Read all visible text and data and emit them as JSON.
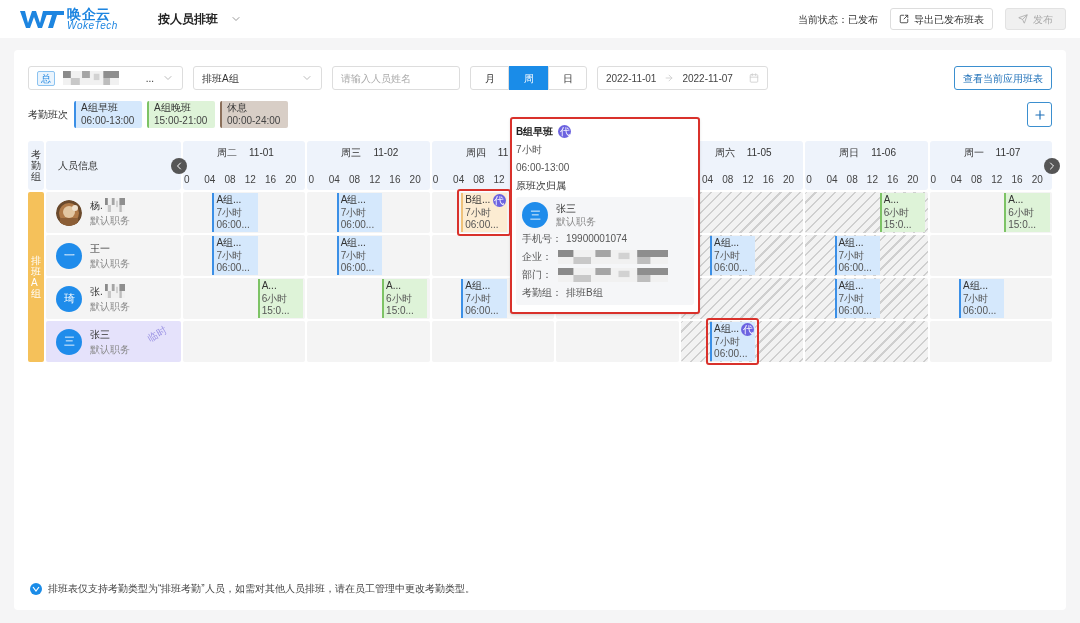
{
  "header": {
    "brand": "唤企云",
    "brand_sub": "WokeTech",
    "title": "按人员排班",
    "status": "当前状态：已发布",
    "export_button": "导出已发布班表",
    "publish_button": {
      "label": "发布",
      "disabled": true
    }
  },
  "filters": {
    "org_select": {
      "tag": "总",
      "value": "...",
      "redacted": true
    },
    "group_select": {
      "value": "排班A组"
    },
    "search": {
      "placeholder": "请输入人员姓名"
    },
    "views": [
      {
        "label": "月",
        "selected": false
      },
      {
        "label": "周",
        "selected": true
      },
      {
        "label": "日",
        "selected": false
      }
    ],
    "date_start": "2022-11-01",
    "date_end": "2022-11-07",
    "view_button": "查看当前应用班表"
  },
  "legend": {
    "label": "考勤班次",
    "shifts": [
      {
        "kind": "early",
        "name": "A组早班",
        "time": "06:00-13:00"
      },
      {
        "kind": "late",
        "name": "A组晚班",
        "time": "15:00-21:00"
      },
      {
        "kind": "rest",
        "name": "休息",
        "time": "00:00-24:00"
      }
    ]
  },
  "grid": {
    "group_header": "考勤组",
    "person_header": "人员信息",
    "group_name": "排班A组",
    "days": [
      {
        "weekday": "周二",
        "date": "11-01",
        "leading_gap": false,
        "hatched": false,
        "ticks": [
          "0",
          "04",
          "08",
          "12",
          "16",
          "20"
        ]
      },
      {
        "weekday": "周三",
        "date": "11-02",
        "leading_gap": false,
        "hatched": false,
        "ticks": [
          "0",
          "04",
          "08",
          "12",
          "16",
          "20"
        ]
      },
      {
        "weekday": "周四",
        "date": "11",
        "leading_gap": false,
        "hatched": false,
        "ticks": [
          "0",
          "04",
          "08",
          "12"
        ]
      },
      {
        "hatched": false
      },
      {
        "weekday": "周六",
        "date": "11-05",
        "leading_gap": true,
        "hatched": true,
        "ticks": [
          "04",
          "08",
          "12",
          "16",
          "20"
        ]
      },
      {
        "weekday": "周日",
        "date": "11-06",
        "leading_gap": false,
        "hatched": true,
        "ticks": [
          "0",
          "04",
          "08",
          "12",
          "16",
          "20"
        ]
      },
      {
        "weekday": "周一",
        "date": "11-07",
        "leading_gap": false,
        "hatched": false,
        "ticks": [
          "0",
          "04",
          "08",
          "12",
          "16",
          "20"
        ]
      }
    ],
    "rows": [
      {
        "name": "杨.",
        "role": "默认职务",
        "redacted": true,
        "selected": false,
        "cells": [
          {
            "kind": "early",
            "title": "A组...",
            "hours": "7小时",
            "time": "06:00...",
            "highlighted": false
          },
          {
            "kind": "early",
            "title": "A组...",
            "hours": "7小时",
            "time": "06:00...",
            "highlighted": false
          },
          {
            "kind": "b_early",
            "title": "B组...",
            "hours": "7小时",
            "time": "06:00...",
            "badge": "代",
            "highlighted": true
          },
          {
            "kind": "empty"
          },
          {
            "kind": "empty"
          },
          {
            "kind": "late",
            "title": "A...",
            "hours": "6小时",
            "time": "15:0...",
            "highlighted": false
          },
          {
            "kind": "late",
            "title": "A...",
            "hours": "6小时",
            "time": "15:0...",
            "highlighted": false
          }
        ]
      },
      {
        "name": "王一",
        "role": "默认职务",
        "avatar": {
          "kind": "initial",
          "text": "一"
        },
        "redacted": false,
        "selected": false,
        "cells": [
          {
            "kind": "early",
            "title": "A组...",
            "hours": "7小时",
            "time": "06:00...",
            "highlighted": false
          },
          {
            "kind": "early",
            "title": "A组...",
            "hours": "7小时",
            "time": "06:00...",
            "highlighted": false
          },
          {
            "kind": "empty"
          },
          {
            "kind": "empty"
          },
          {
            "kind": "early",
            "title": "A组...",
            "hours": "7小时",
            "time": "06:00...",
            "highlighted": false
          },
          {
            "kind": "early",
            "title": "A组...",
            "hours": "7小时",
            "time": "06:00...",
            "highlighted": false
          },
          {
            "kind": "empty"
          }
        ]
      },
      {
        "name": "张.",
        "role": "默认职务",
        "avatar": {
          "kind": "initial",
          "text": "琦"
        },
        "redacted": true,
        "selected": false,
        "cells": [
          {
            "kind": "late",
            "title": "A...",
            "hours": "6小时",
            "time": "15:0...",
            "highlighted": false
          },
          {
            "kind": "late",
            "title": "A...",
            "hours": "6小时",
            "time": "15:0...",
            "highlighted": false
          },
          {
            "kind": "early",
            "title": "A组...",
            "hours": "7小时",
            "time": "06:00...",
            "highlighted": false
          },
          {
            "kind": "empty"
          },
          {
            "kind": "empty"
          },
          {
            "kind": "early",
            "title": "A组...",
            "hours": "7小时",
            "time": "06:00...",
            "highlighted": false
          },
          {
            "kind": "early",
            "title": "A组...",
            "hours": "7小时",
            "time": "06:00...",
            "highlighted": false
          }
        ]
      },
      {
        "name": "张三",
        "role": "默认职务",
        "avatar": {
          "kind": "initial",
          "text": "三"
        },
        "redacted": false,
        "selected": true,
        "mark": "临时",
        "cells": [
          {
            "kind": "empty"
          },
          {
            "kind": "empty"
          },
          {
            "kind": "empty"
          },
          {
            "kind": "empty"
          },
          {
            "kind": "early",
            "title": "A组...",
            "hours": "7小时",
            "time": "06:00...",
            "badge": "代",
            "highlighted": true
          },
          {
            "kind": "empty"
          },
          {
            "kind": "empty"
          }
        ]
      }
    ]
  },
  "popover": {
    "title": "B组早班",
    "badge": "代",
    "hours": "7小时",
    "time": "06:00-13:00",
    "section": "原班次归属",
    "person": {
      "avatar": "三",
      "name": "张三",
      "role": "默认职务"
    },
    "fields": [
      {
        "label": "手机号：",
        "value": "19900001074",
        "redacted": false
      },
      {
        "label": "企业：",
        "redacted": true
      },
      {
        "label": "部门：",
        "redacted": true
      },
      {
        "label": "考勤组：",
        "value": "排班B组",
        "redacted": false
      }
    ]
  },
  "footer_note": "排班表仅支持考勤类型为“排班考勤”人员，如需对其他人员排班，请在员工管理中更改考勤类型。"
}
